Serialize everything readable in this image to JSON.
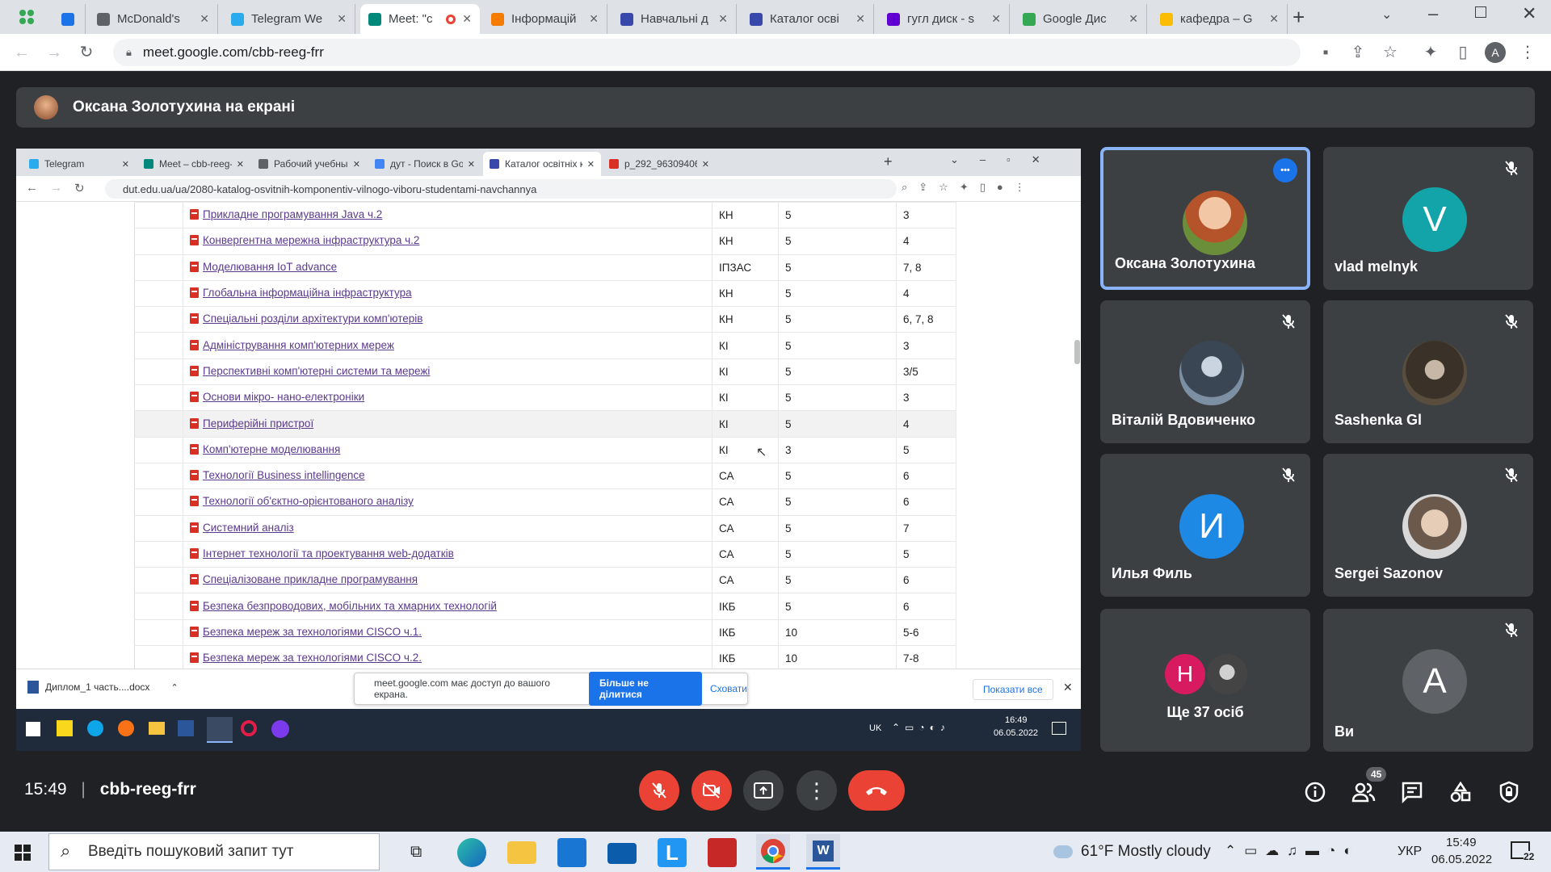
{
  "outer_tabs": [
    {
      "title": "",
      "color": "#1a73e8"
    },
    {
      "title": "McDonald's",
      "color": "#5f6368"
    },
    {
      "title": "Telegram We",
      "color": "#2aabee"
    },
    {
      "title": "Meet: \"c",
      "color": "#00897b",
      "active": true
    },
    {
      "title": "Інформацій",
      "color": "#f57c00"
    },
    {
      "title": "Навчальні д",
      "color": "#3949ab"
    },
    {
      "title": "Каталог осві",
      "color": "#3949ab"
    },
    {
      "title": "гугл диск - s",
      "color": "#6001d2"
    },
    {
      "title": "Google Дис",
      "color": "#34a853"
    },
    {
      "title": "кафедра – G",
      "color": "#fbbc04"
    }
  ],
  "url": "meet.google.com/cbb-reeg-frr",
  "presenting": "Оксана Золотухина на екрані",
  "inner_tabs": [
    {
      "title": "Telegram",
      "color": "#2aabee"
    },
    {
      "title": "Meet – cbb-reeg-",
      "color": "#00897b"
    },
    {
      "title": "Рабочий учебный пл",
      "color": "#5f6368"
    },
    {
      "title": "дут - Поиск в Google",
      "color": "#4285f4"
    },
    {
      "title": "Каталог освітніх комп",
      "color": "#3949ab",
      "active": true
    },
    {
      "title": "p_292_96309406.pdf",
      "color": "#d93025"
    }
  ],
  "inner_url": "dut.edu.ua/ua/2080-katalog-osvitnih-komponentiv-vilnogo-viboru-studentami-navchannya",
  "rows": [
    {
      "name": "Прикладне програмування Java ч.2",
      "dept": "КН",
      "credits": "5",
      "sem": "3"
    },
    {
      "name": "Конвергентна мережна інфраструктура ч.2",
      "dept": "КН",
      "credits": "5",
      "sem": "4"
    },
    {
      "name": "Моделювання IoT advance",
      "dept": "ІПЗАС",
      "credits": "5",
      "sem": "7, 8"
    },
    {
      "name": "Глобальна інформаційна інфраструктура",
      "dept": "КН",
      "credits": "5",
      "sem": "4"
    },
    {
      "name": "Спеціальні розділи архітектури комп'ютерів",
      "dept": "КН",
      "credits": "5",
      "sem": "6, 7, 8"
    },
    {
      "name": "Адміністрування комп'ютерних мереж",
      "dept": "КІ",
      "credits": "5",
      "sem": "3"
    },
    {
      "name": "Перспективні комп'ютерні системи та мережі",
      "dept": "КІ",
      "credits": "5",
      "sem": "3/5"
    },
    {
      "name": "Основи мікро- нано-електроніки",
      "dept": "КІ",
      "credits": "5",
      "sem": "3"
    },
    {
      "name": "Периферійні пристрої",
      "dept": "КІ",
      "credits": "5",
      "sem": "4",
      "highlight": true
    },
    {
      "name": "Комп'ютерне моделювання",
      "dept": "КІ",
      "credits": "3",
      "sem": "5"
    },
    {
      "name": "Технології Business intellingence",
      "dept": "СА",
      "credits": "5",
      "sem": "6"
    },
    {
      "name": "Технології об'єктно-орієнтованого аналізу",
      "dept": "СА",
      "credits": "5",
      "sem": "6"
    },
    {
      "name": "Системний аналіз",
      "dept": "СА",
      "credits": "5",
      "sem": "7"
    },
    {
      "name": "Інтернет технології та проектування web-додатків",
      "dept": "СА",
      "credits": "5",
      "sem": "5"
    },
    {
      "name": "Спеціалізоване прикладне програмування",
      "dept": "СА",
      "credits": "5",
      "sem": "6"
    },
    {
      "name": "Безпека безпроводових, мобільних та хмарних технологій",
      "dept": "ІКБ",
      "credits": "5",
      "sem": "6"
    },
    {
      "name": "Безпека мереж за технологіями CISCO ч.1.",
      "dept": "ІКБ",
      "credits": "10",
      "sem": "5-6"
    },
    {
      "name": "Безпека мереж за технологіями CISCO ч.2.",
      "dept": "ІКБ",
      "credits": "10",
      "sem": "7-8"
    }
  ],
  "download": {
    "file": "Диплом_1 часть....docx",
    "show_all": "Показати все"
  },
  "share_notice": {
    "text": "meet.google.com має доступ до вашого екрана.",
    "stop": "Більше не ділитися",
    "hide": "Сховати"
  },
  "inner_taskbar": {
    "lang": "UK",
    "time": "16:49",
    "date": "06.05.2022"
  },
  "participants": [
    {
      "name": "Оксана Золотухина",
      "initial": "",
      "color": "photo-woman",
      "muted": false,
      "active": true
    },
    {
      "name": "vlad melnyk",
      "initial": "V",
      "color": "#12a4a8",
      "muted": true
    },
    {
      "name": "Віталій Вдовиченко",
      "initial": "",
      "color": "photo-assassin",
      "muted": true
    },
    {
      "name": "Sashenka Gl",
      "initial": "",
      "color": "photo-dark",
      "muted": true
    },
    {
      "name": "Илья Филь",
      "initial": "И",
      "color": "#1e88e5",
      "muted": true
    },
    {
      "name": "Sergei Sazonov",
      "initial": "",
      "color": "photo-man",
      "muted": true
    },
    {
      "name": "Ще 37 осіб",
      "initial": "Н",
      "color": "#d81b60",
      "muted": false
    },
    {
      "name": "Ви",
      "initial": "A",
      "color": "#5f6368",
      "muted": true
    }
  ],
  "meeting": {
    "time": "15:49",
    "code": "cbb-reeg-frr",
    "people_count": "45"
  },
  "windows": {
    "search": "Введіть пошуковий запит тут",
    "weather": "61°F  Mostly cloudy",
    "lang": "УКР",
    "time": "15:49",
    "date": "06.05.2022",
    "notif": "22"
  }
}
